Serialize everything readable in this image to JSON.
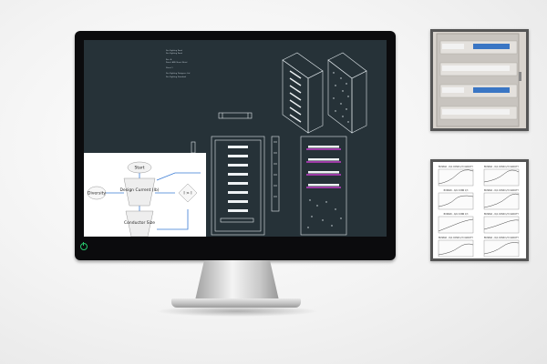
{
  "monitor": {
    "power_color": "#27c66b",
    "screen_background": "#263238"
  },
  "cad": {
    "notes": [
      "Fire Fighting Panel",
      "Fire Fighting Panel",
      "Rev. A",
      "Panel: ARE Sheet Metal",
      "Sheet 1",
      "Fire Fighting Designer: Ltd",
      "Fire Fighting Standard"
    ]
  },
  "flowchart": {
    "nodes": {
      "start": "Start",
      "design_current": "Design Current (Ib)",
      "diversity": "Diversity",
      "conductor_size": "Conductor Size",
      "i_gt_i": "I > I"
    }
  },
  "thumbnails": {
    "photo": {
      "name": "distribution-board-photo"
    },
    "charts": {
      "titles": [
        "BUSBAR – R/A CONN 1/3 CAPACITY",
        "BUSBAR – R/A CONN 1/3 CAPACITY",
        "BUSBAR – R/A CONN 1/3",
        "BUSBAR – R/A CONN 1/3 CAPACITY",
        "BUSBAR – R/A CONN 1/3",
        "BUSBAR – R/A CONN 1/3 CAPACITY",
        "BUSBAR – R/A CONN 1/3 CAPACITY",
        "BUSBAR – R/A CONN 1/3 CAPACITY"
      ]
    }
  }
}
